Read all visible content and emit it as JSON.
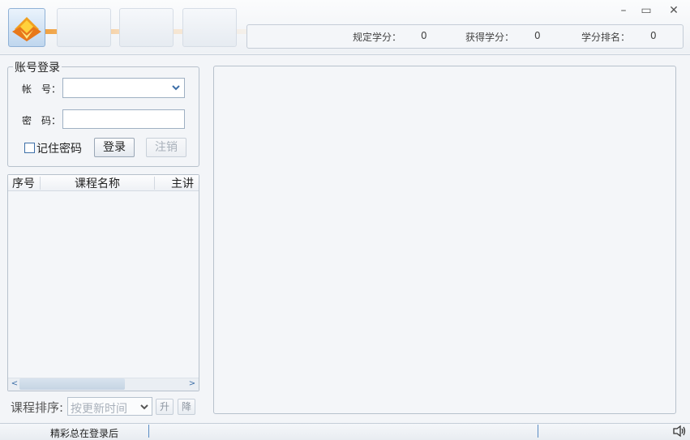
{
  "window": {
    "minimize_glyph": "–",
    "maximize_glyph": "▭",
    "close_glyph": "✕"
  },
  "credits": {
    "required_label": "规定学分：",
    "required_value": "0",
    "earned_label": "获得学分：",
    "earned_value": "0",
    "rank_label": "学分排名：",
    "rank_value": "0"
  },
  "login": {
    "group_title": "账号登录",
    "account_label": "帐　号：",
    "account_value": "",
    "password_label": "密　码：",
    "password_value": "",
    "remember_label": "记住密码",
    "remember_checked": false,
    "login_button": "登录",
    "logout_button": "注销"
  },
  "course_list": {
    "columns": [
      "序号",
      "课程名称",
      "主讲"
    ],
    "rows": [],
    "scroll_left_glyph": "<",
    "scroll_right_glyph": ">"
  },
  "sort": {
    "label": "课程排序:",
    "selected": "按更新时间",
    "asc_button": "升",
    "desc_button": "降"
  },
  "statusbar": {
    "text": "精彩总在登录后"
  },
  "icons": {
    "logo": "diamond-logo-icon",
    "combo_arrow": "chevron-down-icon",
    "speaker": "speaker-icon"
  },
  "colors": {
    "logo_orange": "#f0a020",
    "logo_yellow": "#ffd23c",
    "accent_blue": "#3d6fa8",
    "border": "#b7c1cc"
  }
}
